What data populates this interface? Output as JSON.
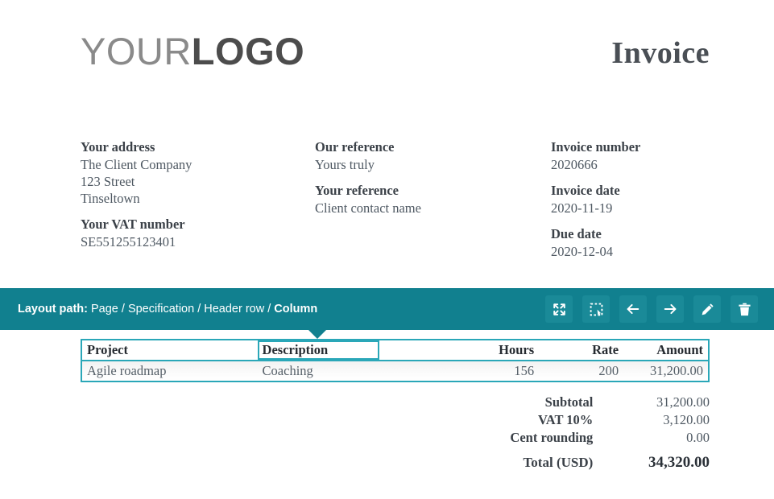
{
  "document": {
    "logo": {
      "light": "YOUR",
      "bold": "LOGO"
    },
    "title": "Invoice"
  },
  "meta": {
    "column1": [
      {
        "label": "Your address",
        "value": "The Client Company\n123 Street\nTinseltown",
        "lines": [
          "The Client Company",
          "123 Street",
          "Tinseltown"
        ]
      },
      {
        "label": "Your VAT number",
        "lines": [
          "SE551255123401"
        ]
      }
    ],
    "column2": [
      {
        "label": "Our reference",
        "lines": [
          "Yours truly"
        ]
      },
      {
        "label": "Your reference",
        "lines": [
          "Client contact name"
        ]
      }
    ],
    "column3": [
      {
        "label": "Invoice number",
        "lines": [
          "2020666"
        ]
      },
      {
        "label": "Invoice date",
        "lines": [
          "2020-11-19"
        ]
      },
      {
        "label": "Due date",
        "lines": [
          "2020-12-04"
        ]
      }
    ],
    "address_label": "Your address",
    "address_line1": "The Client Company",
    "address_line2": "123 Street",
    "address_line3": "Tinseltown",
    "vat_label": "Your VAT number",
    "vat_value": "SE551255123401",
    "our_ref_label": "Our reference",
    "our_ref_value": "Yours truly",
    "your_ref_label": "Your reference",
    "your_ref_value": "Client contact name",
    "invoice_number_label": "Invoice number",
    "invoice_number_value": "2020666",
    "invoice_date_label": "Invoice date",
    "invoice_date_value": "2020-11-19",
    "due_date_label": "Due date",
    "due_date_value": "2020-12-04"
  },
  "toolbar": {
    "layout_path_key": "Layout path:",
    "layout_path_trail": "Page / Specification / Header row /",
    "layout_path_current": "Column",
    "buttons": [
      {
        "name": "expand-icon",
        "title": "Expand"
      },
      {
        "name": "select-area-icon",
        "title": "Select"
      },
      {
        "name": "arrow-left-icon",
        "title": "Previous"
      },
      {
        "name": "arrow-right-icon",
        "title": "Next"
      },
      {
        "name": "pencil-icon",
        "title": "Edit"
      },
      {
        "name": "trash-icon",
        "title": "Delete"
      }
    ],
    "accent_color": "#11808f",
    "button_color": "#1a8a98"
  },
  "specification": {
    "headers": [
      "Project",
      "Description",
      "",
      "Hours",
      "Rate",
      "Amount"
    ],
    "selected_header": "Description",
    "rows": [
      {
        "project": "Agile roadmap",
        "description": "Coaching",
        "blank": "",
        "hours": "156",
        "rate": "200",
        "amount": "31,200.00"
      }
    ],
    "border_color": "#2aa7b8"
  },
  "totals": {
    "rows": [
      {
        "label": "Subtotal",
        "value": "31,200.00"
      },
      {
        "label": "VAT 10%",
        "value": "3,120.00"
      },
      {
        "label": "Cent rounding",
        "value": "0.00"
      }
    ],
    "grand": {
      "label": "Total (USD)",
      "value": "34,320.00"
    }
  }
}
